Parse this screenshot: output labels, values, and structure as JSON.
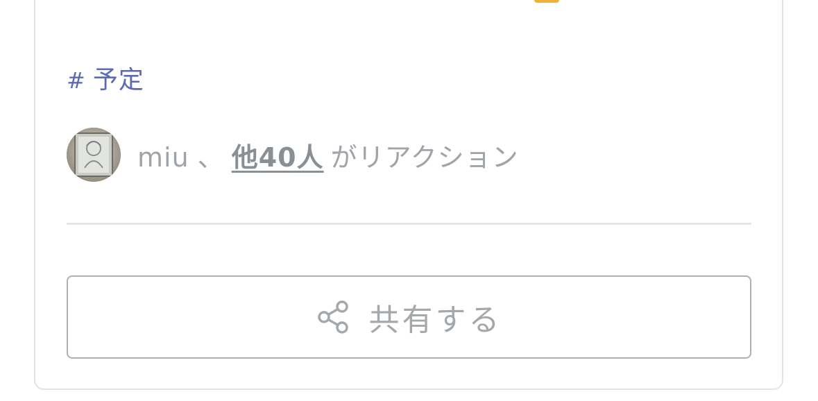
{
  "post": {
    "tag": {
      "hash": "#",
      "label": "予定"
    },
    "reactions": {
      "first_user": "miu",
      "separator": "、",
      "others_link": "他40人",
      "suffix": "がリアクション"
    },
    "share_button": {
      "label": "共有する",
      "icon": "share-icon"
    }
  },
  "colors": {
    "tag": "#5a6bb0",
    "muted_text": "#a0a4a8",
    "border": "#b0b0b0",
    "divider": "#e6e6e6"
  }
}
